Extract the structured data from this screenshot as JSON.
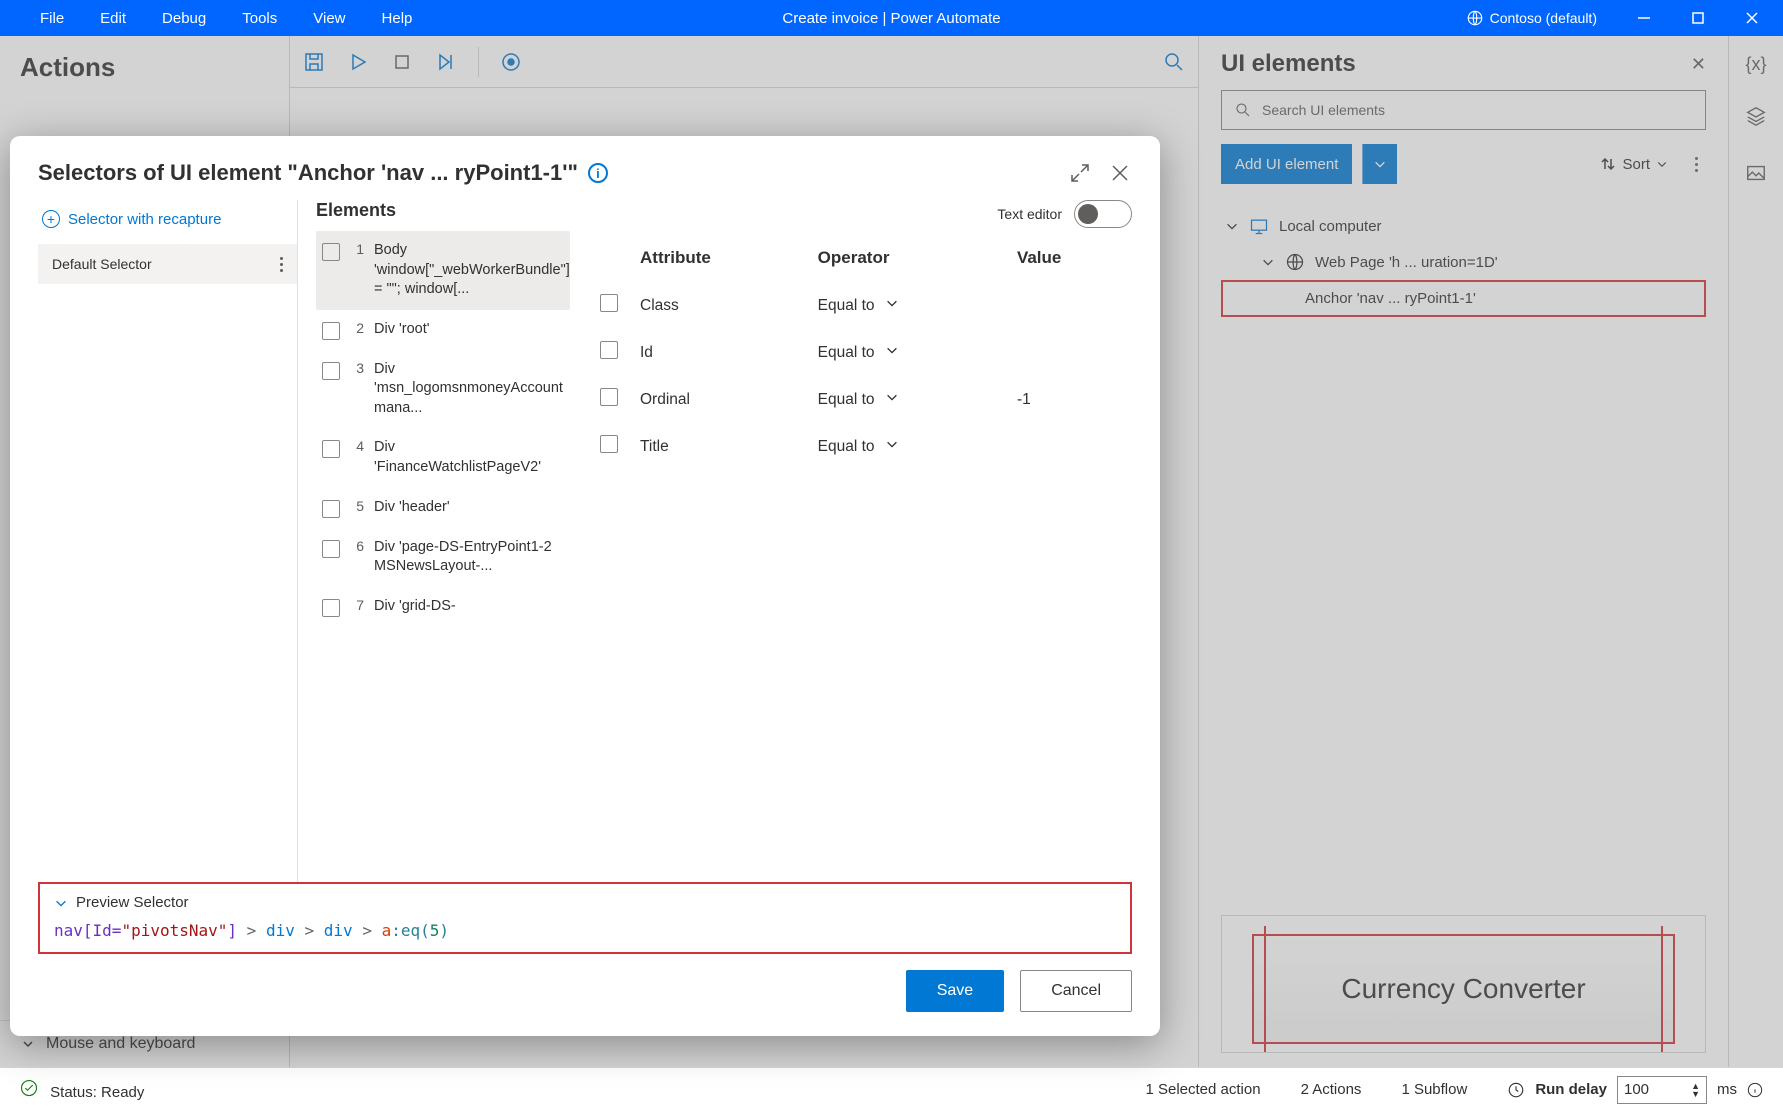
{
  "titlebar": {
    "menu": [
      "File",
      "Edit",
      "Debug",
      "Tools",
      "View",
      "Help"
    ],
    "center": "Create invoice | Power Automate",
    "tenant": "Contoso (default)"
  },
  "leftPanel": {
    "title": "Actions",
    "bottomItem": "Mouse and keyboard"
  },
  "rightPanel": {
    "title": "UI elements",
    "searchPlaceholder": "Search UI elements",
    "addBtn": "Add UI element",
    "sort": "Sort",
    "tree": {
      "lvl1": "Local computer",
      "lvl2": "Web Page 'h ... uration=1D'",
      "lvl3": "Anchor 'nav ... ryPoint1-1'"
    },
    "previewLabel": "Currency Converter"
  },
  "dialog": {
    "title": "Selectors of UI element \"Anchor 'nav ... ryPoint1-1'\"",
    "recapture": "Selector with recapture",
    "defaultSelector": "Default Selector",
    "elementsHeader": "Elements",
    "textEditor": "Text editor",
    "elements": [
      {
        "n": "1",
        "label": "Body 'window[\"_webWorkerBundle\"] = \"\"; window[..."
      },
      {
        "n": "2",
        "label": "Div 'root'"
      },
      {
        "n": "3",
        "label": "Div 'msn_logomsnmoneyAccount mana..."
      },
      {
        "n": "4",
        "label": "Div 'FinanceWatchlistPageV2'"
      },
      {
        "n": "5",
        "label": "Div 'header'"
      },
      {
        "n": "6",
        "label": "Div 'page-DS-EntryPoint1-2 MSNewsLayout-..."
      },
      {
        "n": "7",
        "label": "Div 'grid-DS-"
      }
    ],
    "attrHeaders": {
      "attr": "Attribute",
      "op": "Operator",
      "val": "Value"
    },
    "attrs": [
      {
        "name": "Class",
        "op": "Equal to",
        "val": ""
      },
      {
        "name": "Id",
        "op": "Equal to",
        "val": ""
      },
      {
        "name": "Ordinal",
        "op": "Equal to",
        "val": "-1"
      },
      {
        "name": "Title",
        "op": "Equal to",
        "val": ""
      }
    ],
    "previewTitle": "Preview Selector",
    "selector": {
      "p0": "nav",
      "p1": "[Id=",
      "p2": "\"pivotsNav\"",
      "p3": "] ",
      "gt": ">",
      "div": "div",
      "a": "a",
      "eq": ":eq(",
      "num": "5",
      "close": ")"
    },
    "save": "Save",
    "cancel": "Cancel"
  },
  "status": {
    "ready": "Status: Ready",
    "selAction": "1 Selected action",
    "actions": "2 Actions",
    "subflow": "1 Subflow",
    "runDelay": "Run delay",
    "delayVal": "100",
    "ms": "ms"
  }
}
